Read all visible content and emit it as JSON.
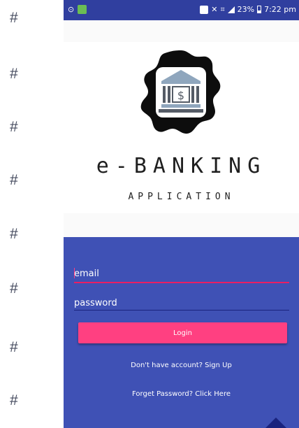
{
  "gutter": {
    "marks": [
      "#",
      "#",
      "#",
      "#",
      "#",
      "#",
      "#",
      "#"
    ]
  },
  "statusbar": {
    "indicators": "⊙",
    "battery_percent": "23%",
    "time": "7:22 pm"
  },
  "brand": {
    "title": "e-BANKING",
    "subtitle": "APPLICATION",
    "logo_icon": "bank-icon",
    "logo_symbol": "$"
  },
  "login": {
    "email_placeholder": "email",
    "password_placeholder": "password",
    "login_label": "Login",
    "signup_link": "Don't have account? Sign Up",
    "forgot_link": "Forget Password? Click Here"
  },
  "colors": {
    "statusbar": "#303f9f",
    "panel": "#3f51b5",
    "accent": "#ff4081"
  }
}
